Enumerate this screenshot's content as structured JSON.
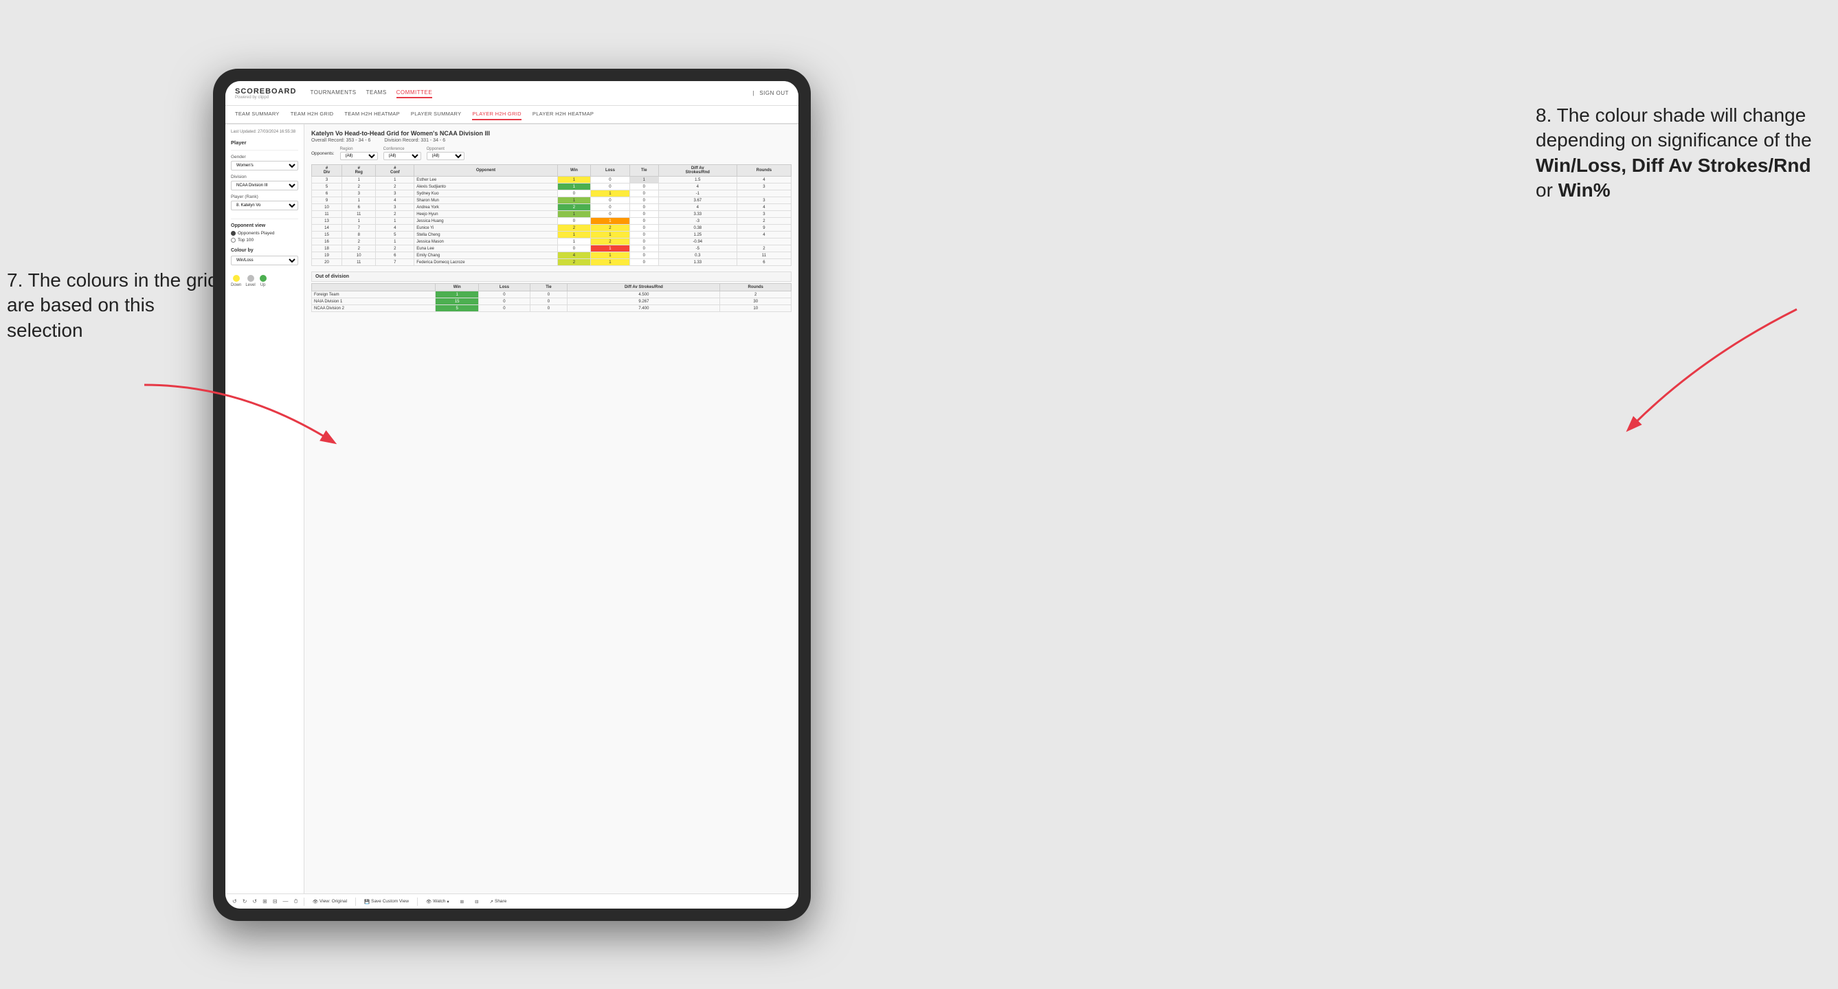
{
  "annotations": {
    "left_title": "7. The colours in the grid are based on this selection",
    "right_title": "8. The colour shade will change depending on significance of the",
    "right_bold1": "Win/Loss,",
    "right_bold2": "Diff Av Strokes/Rnd",
    "right_text": "or",
    "right_bold3": "Win%"
  },
  "nav": {
    "logo": "SCOREBOARD",
    "logo_sub": "Powered by clippd",
    "items": [
      "TOURNAMENTS",
      "TEAMS",
      "COMMITTEE"
    ],
    "active": "COMMITTEE",
    "sign_in": "Sign out"
  },
  "sub_nav": {
    "items": [
      "TEAM SUMMARY",
      "TEAM H2H GRID",
      "TEAM H2H HEATMAP",
      "PLAYER SUMMARY",
      "PLAYER H2H GRID",
      "PLAYER H2H HEATMAP"
    ],
    "active": "PLAYER H2H GRID"
  },
  "sidebar": {
    "last_updated": "Last Updated: 27/03/2024 16:55:38",
    "player_section": "Player",
    "gender_label": "Gender",
    "gender_value": "Women's",
    "division_label": "Division",
    "division_value": "NCAA Division III",
    "player_rank_label": "Player (Rank)",
    "player_rank_value": "8. Katelyn Vo",
    "opponent_view_title": "Opponent view",
    "opponent_played": "Opponents Played",
    "top_100": "Top 100",
    "colour_by_title": "Colour by",
    "colour_by_value": "Win/Loss",
    "legend": {
      "down_label": "Down",
      "level_label": "Level",
      "up_label": "Up"
    }
  },
  "grid": {
    "title": "Katelyn Vo Head-to-Head Grid for Women's NCAA Division III",
    "overall_record": "Overall Record: 353 - 34 - 6",
    "division_record": "Division Record: 331 - 34 - 6",
    "filters": {
      "opponents_label": "Opponents:",
      "region_label": "Region",
      "region_value": "(All)",
      "conference_label": "Conference",
      "conference_value": "(All)",
      "opponent_label": "Opponent",
      "opponent_value": "(All)"
    },
    "table_headers": [
      "#\nDiv",
      "#\nReg",
      "#\nConf",
      "Opponent",
      "Win",
      "Loss",
      "Tie",
      "Diff Av\nStrokes/Rnd",
      "Rounds"
    ],
    "rows": [
      {
        "div": 3,
        "reg": 1,
        "conf": 1,
        "opponent": "Esther Lee",
        "win": 1,
        "loss": 0,
        "tie": 1,
        "diff": 1.5,
        "rounds": 4,
        "win_color": "yellow",
        "loss_color": "white",
        "tie_color": "gray"
      },
      {
        "div": 5,
        "reg": 2,
        "conf": 2,
        "opponent": "Alexis Sudjianto",
        "win": 1,
        "loss": 0,
        "tie": 0,
        "diff": 4.0,
        "rounds": 3,
        "win_color": "green_dark",
        "loss_color": "white",
        "tie_color": "white"
      },
      {
        "div": 6,
        "reg": 3,
        "conf": 3,
        "opponent": "Sydney Kuo",
        "win": 0,
        "loss": 1,
        "tie": 0,
        "diff": -1.0,
        "rounds": "",
        "win_color": "white",
        "loss_color": "yellow",
        "tie_color": "white"
      },
      {
        "div": 9,
        "reg": 1,
        "conf": 4,
        "opponent": "Sharon Mun",
        "win": 1,
        "loss": 0,
        "tie": 0,
        "diff": 3.67,
        "rounds": 3,
        "win_color": "green_med",
        "loss_color": "white",
        "tie_color": "white"
      },
      {
        "div": 10,
        "reg": 6,
        "conf": 3,
        "opponent": "Andrea York",
        "win": 2,
        "loss": 0,
        "tie": 0,
        "diff": 4.0,
        "rounds": 4,
        "win_color": "green_dark",
        "loss_color": "white",
        "tie_color": "white"
      },
      {
        "div": 11,
        "reg": 11,
        "conf": 2,
        "opponent": "Heejo Hyun",
        "win": 1,
        "loss": 0,
        "tie": 0,
        "diff": 3.33,
        "rounds": 3,
        "win_color": "green_med",
        "loss_color": "white",
        "tie_color": "white"
      },
      {
        "div": 13,
        "reg": 1,
        "conf": 1,
        "opponent": "Jessica Huang",
        "win": 0,
        "loss": 1,
        "tie": 0,
        "diff": -3.0,
        "rounds": 2,
        "win_color": "white",
        "loss_color": "orange",
        "tie_color": "white"
      },
      {
        "div": 14,
        "reg": 7,
        "conf": 4,
        "opponent": "Eunice Yi",
        "win": 2,
        "loss": 2,
        "tie": 0,
        "diff": 0.38,
        "rounds": 9,
        "win_color": "yellow",
        "loss_color": "yellow",
        "tie_color": "white"
      },
      {
        "div": 15,
        "reg": 8,
        "conf": 5,
        "opponent": "Stella Cheng",
        "win": 1,
        "loss": 1,
        "tie": 0,
        "diff": 1.25,
        "rounds": 4,
        "win_color": "yellow",
        "loss_color": "yellow",
        "tie_color": "white"
      },
      {
        "div": 16,
        "reg": 2,
        "conf": 1,
        "opponent": "Jessica Mason",
        "win": 1,
        "loss": 2,
        "tie": 0,
        "diff": -0.94,
        "rounds": "",
        "win_color": "white",
        "loss_color": "yellow",
        "tie_color": "white"
      },
      {
        "div": 18,
        "reg": 2,
        "conf": 2,
        "opponent": "Euna Lee",
        "win": 0,
        "loss": 1,
        "tie": 0,
        "diff": -5.0,
        "rounds": 2,
        "win_color": "white",
        "loss_color": "red",
        "tie_color": "white"
      },
      {
        "div": 19,
        "reg": 10,
        "conf": 6,
        "opponent": "Emily Chang",
        "win": 4,
        "loss": 1,
        "tie": 0,
        "diff": 0.3,
        "rounds": 11,
        "win_color": "green_light",
        "loss_color": "yellow",
        "tie_color": "white"
      },
      {
        "div": 20,
        "reg": 11,
        "conf": 7,
        "opponent": "Federica Domecq Lacroze",
        "win": 2,
        "loss": 1,
        "tie": 0,
        "diff": 1.33,
        "rounds": 6,
        "win_color": "green_light",
        "loss_color": "yellow",
        "tie_color": "white"
      }
    ],
    "out_of_division_title": "Out of division",
    "out_of_division_rows": [
      {
        "opponent": "Foreign Team",
        "win": 1,
        "loss": 0,
        "tie": 0,
        "diff": 4.5,
        "rounds": 2,
        "win_color": "green_dark"
      },
      {
        "opponent": "NAIA Division 1",
        "win": 15,
        "loss": 0,
        "tie": 0,
        "diff": 9.267,
        "rounds": 30,
        "win_color": "green_dark"
      },
      {
        "opponent": "NCAA Division 2",
        "win": 5,
        "loss": 0,
        "tie": 0,
        "diff": 7.4,
        "rounds": 10,
        "win_color": "green_dark"
      }
    ]
  },
  "toolbar": {
    "view_original": "View: Original",
    "save_custom_view": "Save Custom View",
    "watch": "Watch",
    "share": "Share"
  },
  "colors": {
    "green_dark": "#4caf50",
    "green_med": "#8bc34a",
    "green_light": "#cddc39",
    "yellow": "#ffeb3b",
    "orange": "#ff9800",
    "red": "#f44336",
    "accent": "#e63946"
  }
}
